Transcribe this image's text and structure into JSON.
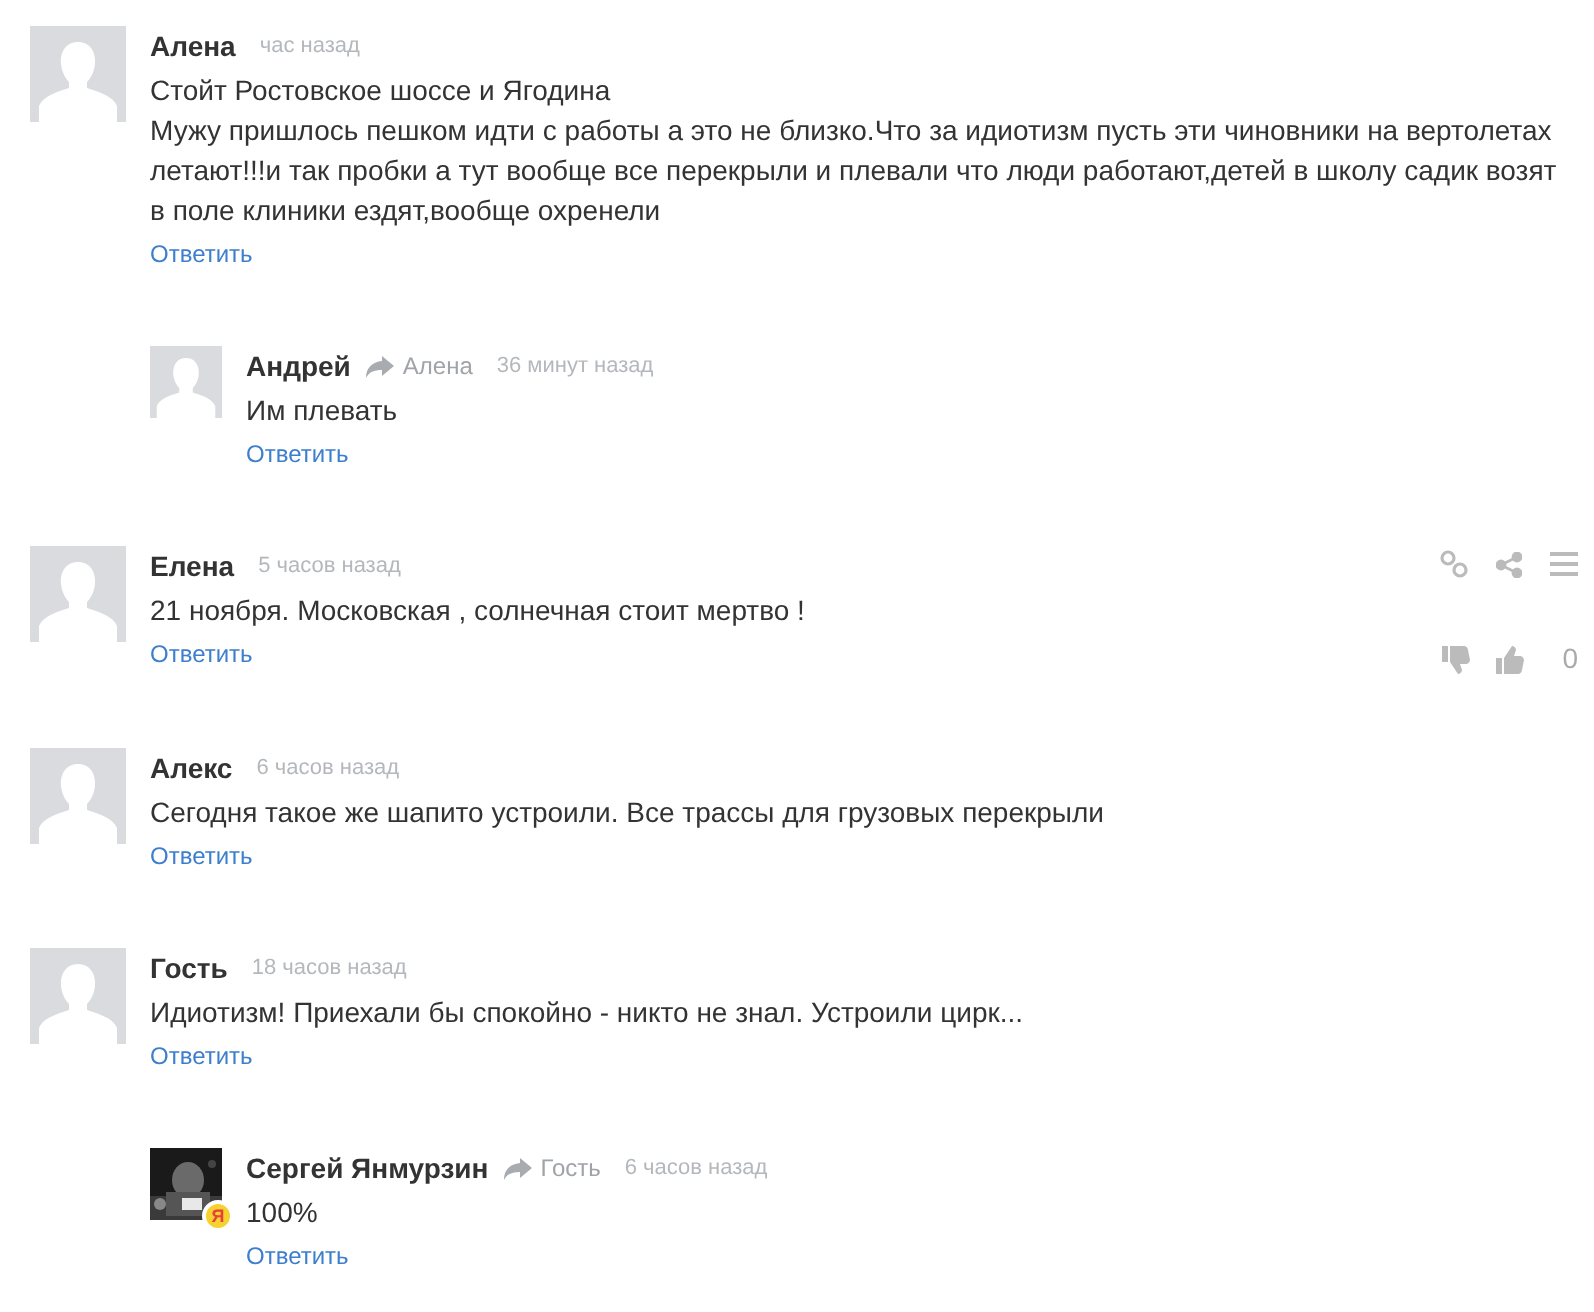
{
  "comments": [
    {
      "author": "Алена",
      "time": "час назад",
      "lines": [
        "Стойт Ростовское шоссе и Ягодина",
        "Мужу пришлось пешком идти с работы а это не близко.Что за идиотизм пусть эти чиновники на вертолетах летают!!!и так пробки а тут вообще все перекрыли и плевали что люди работают,детей в школу садик возят в поле клиники ездят,вообще охренели"
      ],
      "reply_label": "Ответить",
      "avatar": {
        "kind": "placeholder"
      },
      "replies": [
        {
          "author": "Андрей",
          "reply_to": "Алена",
          "time": "36 минут назад",
          "lines": [
            "Им плевать"
          ],
          "reply_label": "Ответить",
          "avatar": {
            "kind": "placeholder"
          }
        }
      ]
    },
    {
      "author": "Елена",
      "time": "5 часов назад",
      "lines": [
        "21 ноября. Московская , солнечная стоит мертво !"
      ],
      "reply_label": "Ответить",
      "avatar": {
        "kind": "placeholder"
      },
      "actions": {
        "votes": "0"
      }
    },
    {
      "author": "Алекс",
      "time": "6 часов назад",
      "lines": [
        "Сегодня такое же шапито устроили. Все трассы для грузовых перекрыли"
      ],
      "reply_label": "Ответить",
      "avatar": {
        "kind": "placeholder"
      }
    },
    {
      "author": "Гость",
      "time": "18 часов назад",
      "lines": [
        "Идиотизм! Приехали бы спокойно - никто не знал. Устроили цирк..."
      ],
      "reply_label": "Ответить",
      "avatar": {
        "kind": "placeholder"
      },
      "replies": [
        {
          "author": "Сергей Янмурзин",
          "reply_to": "Гость",
          "time": "6 часов назад",
          "lines": [
            "100%"
          ],
          "reply_label": "Ответить",
          "avatar": {
            "badge": "Я"
          }
        }
      ]
    }
  ]
}
